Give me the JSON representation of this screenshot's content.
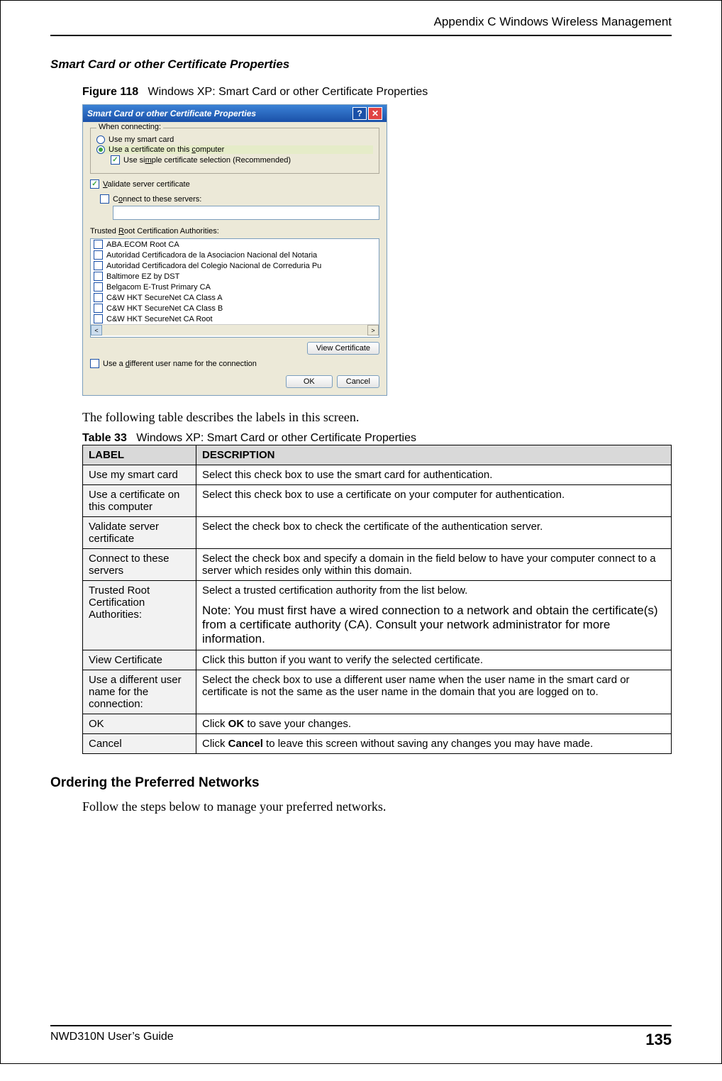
{
  "header": {
    "appendix": "Appendix C Windows Wireless Management"
  },
  "section": {
    "title": "Smart Card or other Certificate Properties"
  },
  "figure": {
    "num": "Figure 118",
    "caption": "Windows XP: Smart Card or other Certificate Properties"
  },
  "dialog": {
    "title": "Smart Card or other Certificate Properties",
    "legend": "When connecting:",
    "opt_smartcard": "Use my smart card",
    "opt_cert_pre": "Use a certificate on this ",
    "opt_cert_ul": "c",
    "opt_cert_post": "omputer",
    "simple_pre": "Use si",
    "simple_ul": "m",
    "simple_post": "ple certificate selection (Recommended)",
    "validate_ul": "V",
    "validate_post": "alidate server certificate",
    "connect_pre": "C",
    "connect_ul": "o",
    "connect_post": "nnect to these servers:",
    "trusted_pre": "Trusted ",
    "trusted_ul": "R",
    "trusted_post": "oot Certification Authorities:",
    "authorities": [
      "ABA.ECOM Root CA",
      "Autoridad Certificadora de la Asociacion Nacional del Notaria",
      "Autoridad Certificadora del Colegio Nacional de Correduria Pu",
      "Baltimore EZ by DST",
      "Belgacom E-Trust Primary CA",
      "C&W HKT SecureNet CA Class A",
      "C&W HKT SecureNet CA Class B",
      "C&W HKT SecureNet CA Root"
    ],
    "view_cert": "View Certificate",
    "diff_user_pre": "Use a ",
    "diff_user_ul": "d",
    "diff_user_post": "ifferent user name for the connection",
    "ok": "OK",
    "cancel": "Cancel"
  },
  "below_text": "The following table describes the labels in this screen.",
  "table": {
    "num": "Table 33",
    "caption": "Windows XP: Smart Card or other Certificate Properties",
    "h1": "LABEL",
    "h2": "DESCRIPTION",
    "rows": [
      {
        "label": "Use my smart card",
        "desc": "Select this check box to use the smart card for authentication."
      },
      {
        "label": "Use a certificate on this computer",
        "desc": "Select this check box to use a certificate on your computer for authentication."
      },
      {
        "label": "Validate server certificate",
        "desc": "Select the check box to check the certificate of the authentication server."
      },
      {
        "label": "Connect to these servers",
        "desc": "Select the check box and specify a domain in the field below to have your computer connect to a server which resides only within this domain."
      },
      {
        "label": "Trusted Root Certification Authorities:",
        "desc": "Select a trusted certification authority from the list below.",
        "note": "Note: You must first have a wired connection to a network and obtain the certificate(s) from a certificate authority (CA). Consult your network administrator for more information."
      },
      {
        "label": "View Certificate",
        "desc": "Click this button if you want to verify the selected certificate."
      },
      {
        "label": "Use a different user name for the connection:",
        "desc": "Select the check box to use a different user name when the user name in the smart card or certificate is not the same as the user name in the domain that you are logged on to."
      },
      {
        "label": "OK",
        "desc_pre": "Click ",
        "desc_bold": "OK",
        "desc_post": " to save your changes."
      },
      {
        "label": "Cancel",
        "desc_pre": "Click ",
        "desc_bold": "Cancel",
        "desc_post": " to leave this screen without saving any changes you may have made."
      }
    ]
  },
  "subsection2": {
    "title": "Ordering the Preferred Networks",
    "body": "Follow the steps below to manage your preferred networks."
  },
  "footer": {
    "guide": "NWD310N User’s Guide",
    "page": "135"
  }
}
